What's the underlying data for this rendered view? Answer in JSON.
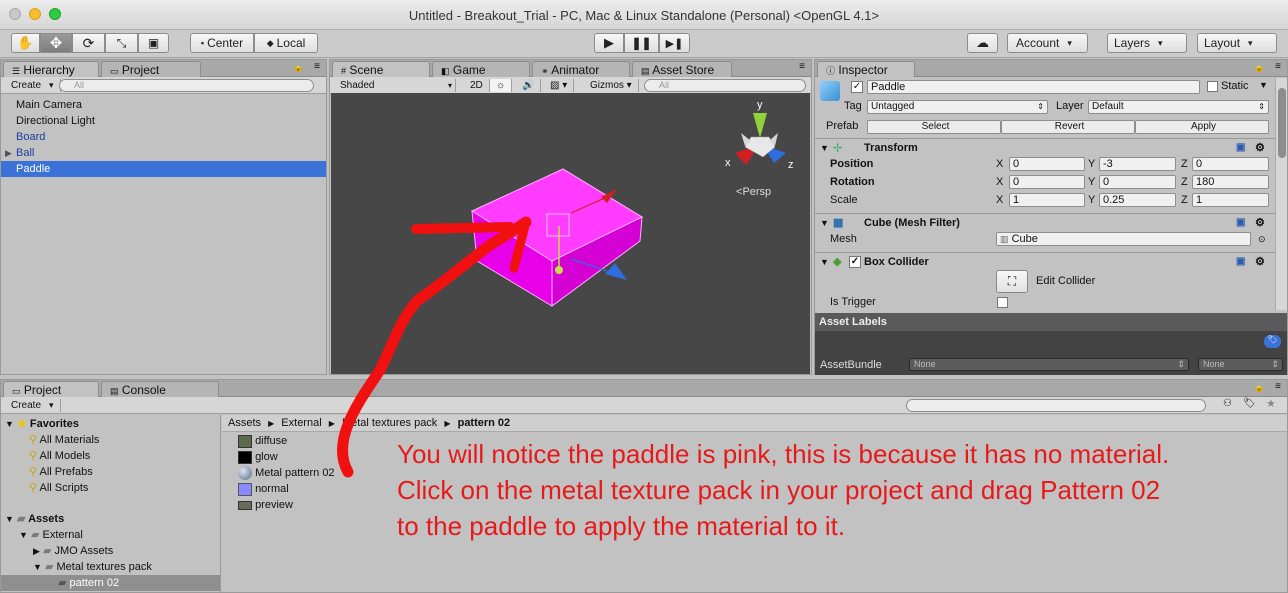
{
  "window": {
    "title": "Untitled - Breakout_Trial - PC, Mac & Linux Standalone (Personal) <OpenGL 4.1>"
  },
  "toolbar": {
    "pivot_label": "Center",
    "space_label": "Local",
    "account_label": "Account",
    "layers_label": "Layers",
    "layout_label": "Layout"
  },
  "hierarchy": {
    "tab_label": "Hierarchy",
    "project_tab_label": "Project",
    "create_label": "Create",
    "search_placeholder": "All",
    "items": [
      {
        "label": "Main Camera"
      },
      {
        "label": "Directional Light"
      },
      {
        "label": "Board"
      },
      {
        "label": "Ball"
      },
      {
        "label": "Paddle"
      }
    ]
  },
  "scene": {
    "tabs": [
      {
        "label": "Scene"
      },
      {
        "label": "Game"
      },
      {
        "label": "Animator"
      },
      {
        "label": "Asset Store"
      }
    ],
    "shading_label": "Shaded",
    "mode_2d_label": "2D",
    "gizmos_label": "Gizmos",
    "search_placeholder": "All",
    "persp_label": "Persp",
    "axis_x": "x",
    "axis_y": "y",
    "axis_z": "z"
  },
  "inspector": {
    "tab_label": "Inspector",
    "object_name": "Paddle",
    "static_label": "Static",
    "tag_label": "Tag",
    "tag_value": "Untagged",
    "layer_label": "Layer",
    "layer_value": "Default",
    "prefab_label": "Prefab",
    "prefab_select": "Select",
    "prefab_revert": "Revert",
    "prefab_apply": "Apply",
    "transform": {
      "title": "Transform",
      "position_label": "Position",
      "rotation_label": "Rotation",
      "scale_label": "Scale",
      "x_label": "X",
      "y_label": "Y",
      "z_label": "Z",
      "position": {
        "x": "0",
        "y": "-3",
        "z": "0"
      },
      "rotation": {
        "x": "0",
        "y": "0",
        "z": "180"
      },
      "scale": {
        "x": "1",
        "y": "0.25",
        "z": "1"
      }
    },
    "mesh_filter": {
      "title": "Cube (Mesh Filter)",
      "mesh_label": "Mesh",
      "mesh_value": "Cube"
    },
    "box_collider": {
      "title": "Box Collider",
      "edit_label": "Edit Collider",
      "trigger_label": "Is Trigger"
    },
    "asset_labels": "Asset Labels",
    "assetbundle_label": "AssetBundle",
    "assetbundle_value": "None",
    "assetbundle_variant": "None"
  },
  "project": {
    "tab_label": "Project",
    "console_tab_label": "Console",
    "create_label": "Create",
    "favorites_label": "Favorites",
    "favorites": [
      {
        "label": "All Materials"
      },
      {
        "label": "All Models"
      },
      {
        "label": "All Prefabs"
      },
      {
        "label": "All Scripts"
      }
    ],
    "assets_label": "Assets",
    "tree": [
      {
        "label": "External"
      },
      {
        "label": "JMO Assets"
      },
      {
        "label": "Metal textures pack"
      },
      {
        "label": "pattern 02"
      }
    ],
    "breadcrumb": [
      "Assets",
      "External",
      "Metal textures pack",
      "pattern 02"
    ],
    "files": [
      {
        "label": "diffuse"
      },
      {
        "label": "glow"
      },
      {
        "label": "Metal pattern 02"
      },
      {
        "label": "normal"
      },
      {
        "label": "preview"
      }
    ]
  },
  "annotation": {
    "lines": [
      "You will notice the paddle is pink, this is because it has no material.",
      "Click on the metal texture pack in your project and drag Pattern 02",
      "to the paddle to apply the material to it."
    ]
  },
  "colors": {
    "annotation": "#e61a1a",
    "selection": "#3a72d8",
    "paddle": "#ff00ff"
  }
}
